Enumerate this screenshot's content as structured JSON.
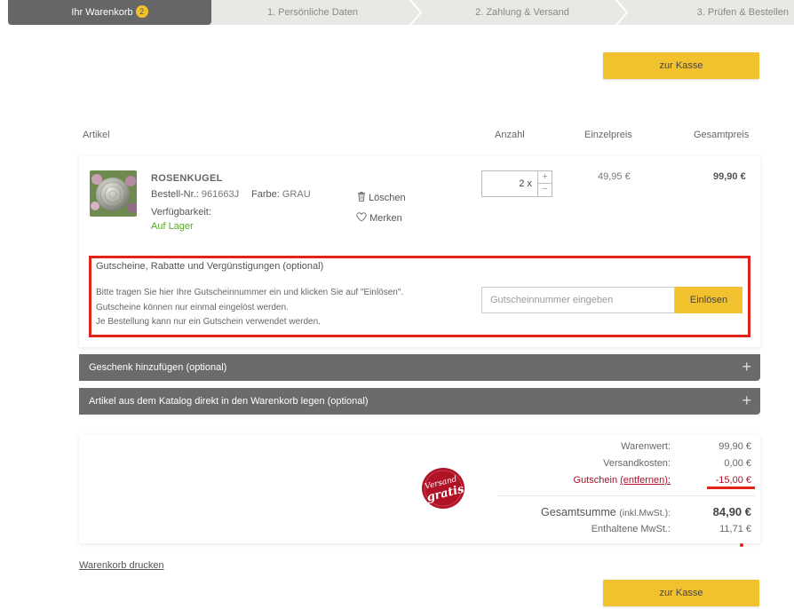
{
  "steps": [
    {
      "label": "Ihr Warenkorb",
      "badge": "2"
    },
    {
      "label": "1. Persönliche Daten"
    },
    {
      "label": "2. Zahlung & Versand"
    },
    {
      "label": "3. Prüfen & Bestellen"
    }
  ],
  "checkout_label": "zur Kasse",
  "table": {
    "col_article": "Artikel",
    "col_qty": "Anzahl",
    "col_unit": "Einzelpreis",
    "col_total": "Gesamtpreis"
  },
  "product": {
    "name": "ROSENKUGEL",
    "order_label": "Bestell-Nr.:",
    "order_no": "961663J",
    "color_label": "Farbe:",
    "color": "GRAU",
    "availability_label": "Verfügbarkeit:",
    "availability": "Auf Lager",
    "delete_label": "Löschen",
    "remember_label": "Merken",
    "quantity": "2 x",
    "unit_price": "49,95 €",
    "total_price": "99,90 €"
  },
  "coupon": {
    "title": "Gutscheine, Rabatte und Vergünstigungen (optional)",
    "line1": "Bitte tragen Sie hier Ihre Gutscheinnummer ein und klicken Sie auf \"Einlösen\".",
    "line2": "Gutscheine können nur einmal eingelöst werden.",
    "line3": "Je Bestellung kann nur ein Gutschein verwendet werden.",
    "placeholder": "Gutscheinnummer eingeben",
    "redeem_label": "Einlösen"
  },
  "accordions": [
    {
      "label": "Geschenk hinzufügen (optional)"
    },
    {
      "label": "Artikel aus dem Katalog direkt in den Warenkorb legen (optional)"
    }
  ],
  "summary": {
    "goods_label": "Warenwert:",
    "goods_value": "99,90 €",
    "shipping_label": "Versandkosten:",
    "shipping_value": "0,00 €",
    "voucher_label": "Gutschein",
    "voucher_remove": "(entfernen):",
    "voucher_value": "-15,00 €",
    "total_label": "Gesamtsumme",
    "total_note": "(inkl.MwSt.):",
    "total_value": "84,90 €",
    "vat_label": "Enthaltene MwSt.:",
    "vat_value": "11,71 €",
    "seal_line1": "Versand",
    "seal_line2": "gratis"
  },
  "print_link": "Warenkorb drucken",
  "colors": {
    "accent": "#f2c12e",
    "highlight": "#e2231a",
    "dark_bar": "#6b6b6b",
    "stock_green": "#5aa82a",
    "voucher_red": "#b0102a"
  }
}
